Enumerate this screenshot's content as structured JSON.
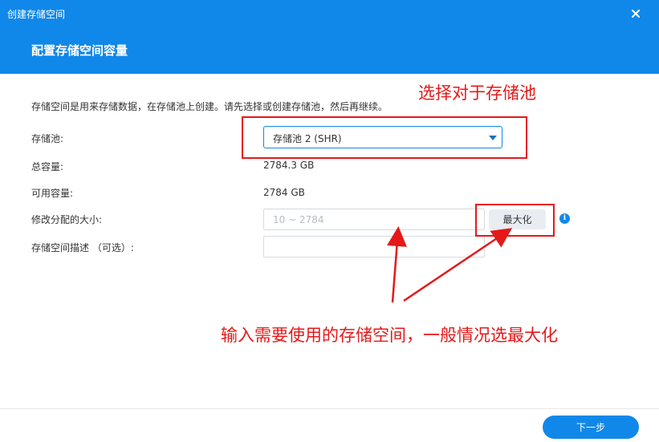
{
  "window": {
    "title": "创建存储空间",
    "close_icon": "close-icon"
  },
  "header": {
    "title": "配置存储空间容量"
  },
  "description": "存储空间是用来存储数据，在存储池上创建。请先选择或创建存储池，然后再继续。",
  "form": {
    "pool": {
      "label": "存储池:",
      "selected": "存储池 2 (SHR)"
    },
    "total_capacity": {
      "label": "总容量:",
      "value": "2784.3 GB"
    },
    "available_capacity": {
      "label": "可用容量:",
      "value": "2784 GB"
    },
    "allocated_size": {
      "label": "修改分配的大小:",
      "placeholder": "10 ~ 2784",
      "value": ""
    },
    "max_button": "最大化",
    "info_icon": "i",
    "description_field": {
      "label": "存储空间描述 （可选）:",
      "value": ""
    }
  },
  "footer": {
    "next_button": "下一步"
  },
  "annotations": {
    "pool_note": "选择对于存储池",
    "size_note": "输入需要使用的存储空间，一般情况选最大化",
    "color": "#e51919"
  },
  "colors": {
    "accent": "#1088e9",
    "header_bg": "#1088e9"
  }
}
